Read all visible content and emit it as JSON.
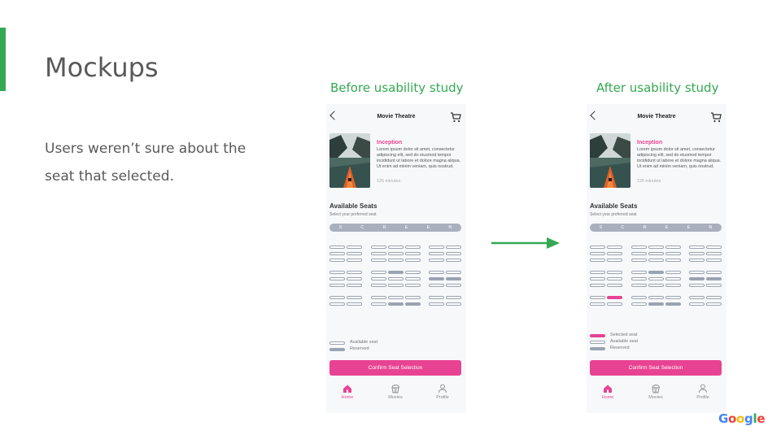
{
  "slide": {
    "title": "Mockups",
    "body": "Users weren’t sure about the seat that selected.",
    "before_label": "Before usability study",
    "after_label": "After usability study",
    "google_letters": [
      {
        "ch": "G",
        "color": "#4285f4"
      },
      {
        "ch": "o",
        "color": "#ea4335"
      },
      {
        "ch": "o",
        "color": "#fbbc05"
      },
      {
        "ch": "g",
        "color": "#4285f4"
      },
      {
        "ch": "l",
        "color": "#34a853"
      },
      {
        "ch": "e",
        "color": "#ea4335"
      }
    ],
    "colors": {
      "accent": "#34a853",
      "pink": "#e84393",
      "reserved": "#9aa3b1",
      "text": "#595959"
    }
  },
  "before": {
    "header_title": "Movie Theatre",
    "movie_title": "Inception",
    "description": "Lorem ipsum dolor sit amet, consectetur adipiscing elit, sed do eiusmod tempor incididunt ut labore et dolore magna aliqua. Ut enim ad minim veniam, quis nostrud.",
    "duration": "126 minutes",
    "seats_heading": "Available Seats",
    "seats_subheading": "Select your preferred seat",
    "screen_letters": [
      "S",
      "C",
      "R",
      "E",
      "E",
      "N"
    ],
    "seat_map": [
      "......",
      "......",
      "......",
      ".....",
      "...R..",
      ".....RR",
      "......",
      ".......",
      "...RR.."
    ],
    "legend": [
      {
        "type": "available",
        "label": "Available seat"
      },
      {
        "type": "reserved",
        "label": "Reserved"
      }
    ],
    "confirm_label": "Confirm Seat Selection",
    "nav": [
      {
        "label": "Home",
        "icon": "home-icon",
        "active": true
      },
      {
        "label": "Movies",
        "icon": "popcorn-icon",
        "active": false
      },
      {
        "label": "Profile",
        "icon": "profile-icon",
        "active": false
      }
    ]
  },
  "after": {
    "header_title": "Movie Theatre",
    "movie_title": "Inception",
    "description": "Lorem ipsum dolor sit amet, consectetur adipiscing elit, sed do eiusmod tempor incididunt ut labore et dolore magna aliqua. Ut enim ad minim veniam, quis nostrud.",
    "duration": "126 minutes",
    "seats_heading": "Available Seats",
    "seats_subheading": "Select your preferred seat",
    "screen_letters": [
      "S",
      "C",
      "R",
      "E",
      "E",
      "N"
    ],
    "seat_map": [
      "......",
      "......",
      "......",
      ".....",
      "...R..",
      ".....RR",
      "......",
      ".X.....",
      "...RR.."
    ],
    "legend": [
      {
        "type": "selected",
        "label": "Selected seat"
      },
      {
        "type": "available",
        "label": "Available seat"
      },
      {
        "type": "reserved",
        "label": "Reserved"
      }
    ],
    "confirm_label": "Confirm Seat Selection",
    "nav": [
      {
        "label": "Home",
        "icon": "home-icon",
        "active": true
      },
      {
        "label": "Movies",
        "icon": "popcorn-icon",
        "active": false
      },
      {
        "label": "Profile",
        "icon": "profile-icon",
        "active": false
      }
    ]
  }
}
